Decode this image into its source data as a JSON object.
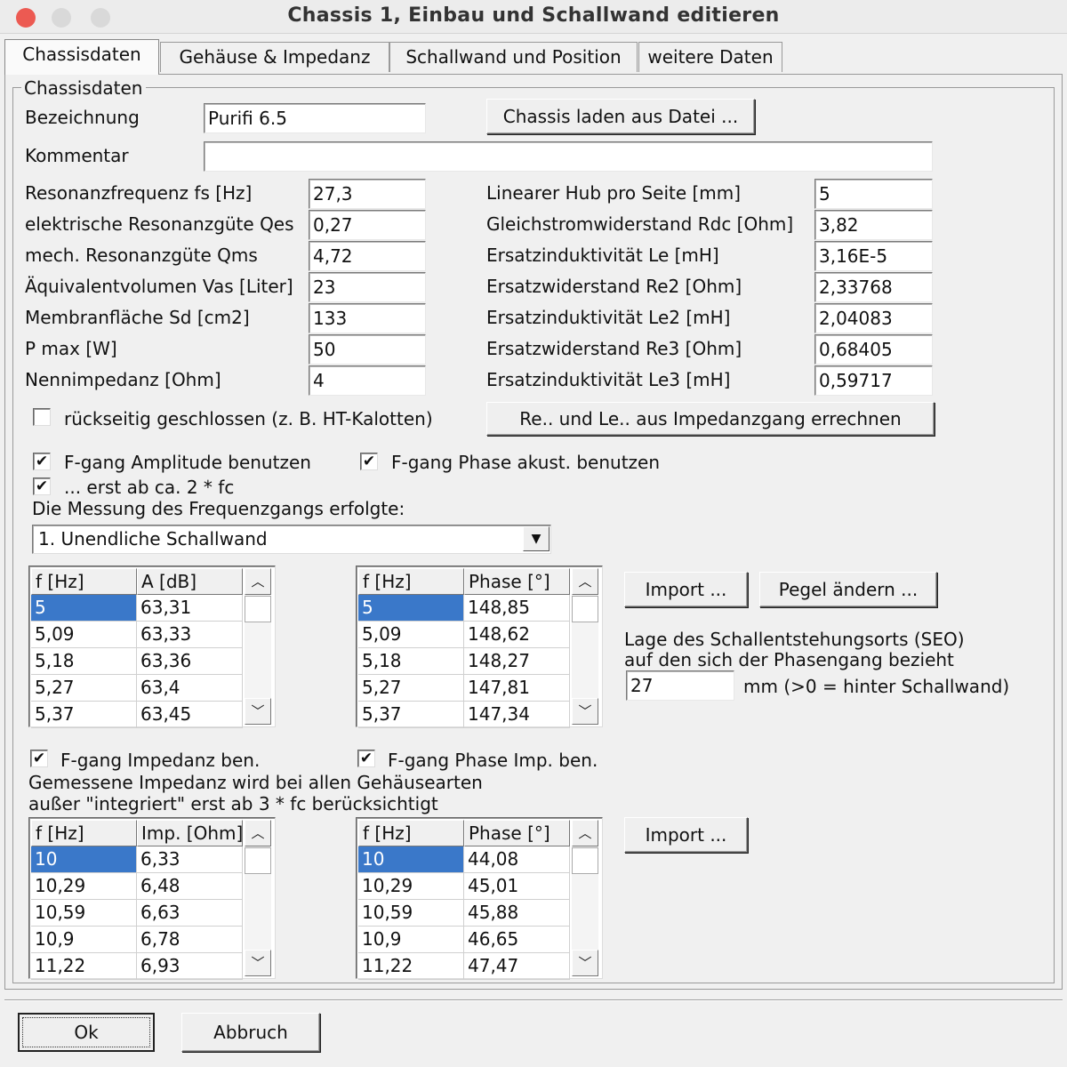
{
  "window": {
    "title": "Chassis 1, Einbau und Schallwand editieren"
  },
  "tabs": [
    "Chassisdaten",
    "Gehäuse & Impedanz",
    "Schallwand und Position",
    "weitere Daten"
  ],
  "group_title": "Chassisdaten",
  "bezeichnung": {
    "label": "Bezeichnung",
    "value": "Purifi 6.5"
  },
  "load_button": "Chassis laden aus Datei ...",
  "kommentar": {
    "label": "Kommentar",
    "value": ""
  },
  "params_left": [
    {
      "label": "Resonanzfrequenz fs [Hz]",
      "value": "27,3"
    },
    {
      "label": "elektrische Resonanzgüte Qes",
      "value": "0,27"
    },
    {
      "label": "mech. Resonanzgüte Qms",
      "value": "4,72"
    },
    {
      "label": "Äquivalentvolumen Vas [Liter]",
      "value": "23"
    },
    {
      "label": "Membranfläche Sd [cm2]",
      "value": "133"
    },
    {
      "label": "P max  [W]",
      "value": "50"
    },
    {
      "label": "Nennimpedanz  [Ohm]",
      "value": "4"
    }
  ],
  "params_right": [
    {
      "label": "Linearer Hub pro Seite [mm]",
      "value": "5"
    },
    {
      "label": "Gleichstromwiderstand Rdc [Ohm]",
      "value": "3,82"
    },
    {
      "label": "Ersatzinduktivität Le [mH]",
      "value": "3,16E-5"
    },
    {
      "label": "Ersatzwiderstand Re2 [Ohm]",
      "value": "2,33768"
    },
    {
      "label": "Ersatzinduktivität Le2 [mH]",
      "value": "2,04083"
    },
    {
      "label": "Ersatzwiderstand Re3 [Ohm]",
      "value": "0,68405"
    },
    {
      "label": "Ersatzinduktivität Le3 [mH]",
      "value": "0,59717"
    }
  ],
  "rear_closed": {
    "label": "rückseitig geschlossen (z. B. HT-Kalotten)",
    "checked": false
  },
  "calc_button": "Re.. und Le.. aus Impedanzgang errechnen",
  "fgang_amp": {
    "label": "F-gang Amplitude benutzen",
    "checked": true
  },
  "fgang_phase": {
    "label": "F-gang Phase akust. benutzen",
    "checked": true
  },
  "erst_ab": {
    "label": "... erst ab ca. 2 * fc",
    "checked": true
  },
  "measurement_label": "Die Messung des Frequenzgangs erfolgte:",
  "measurement_value": "1. Unendliche Schallwand",
  "amp_table": {
    "headers": [
      "f [Hz]",
      "A [dB]"
    ],
    "rows": [
      [
        "5",
        "63,31"
      ],
      [
        "5,09",
        "63,33"
      ],
      [
        "5,18",
        "63,36"
      ],
      [
        "5,27",
        "63,4"
      ],
      [
        "5,37",
        "63,45"
      ]
    ]
  },
  "phase_table": {
    "headers": [
      "f [Hz]",
      "Phase [°]"
    ],
    "rows": [
      [
        "5",
        "148,85"
      ],
      [
        "5,09",
        "148,62"
      ],
      [
        "5,18",
        "148,27"
      ],
      [
        "5,27",
        "147,81"
      ],
      [
        "5,37",
        "147,34"
      ]
    ]
  },
  "import_button": "Import ...",
  "pegel_button": "Pegel ändern ...",
  "seo": {
    "line1": "Lage des Schallentstehungsorts (SEO)",
    "line2": "auf den sich der Phasengang bezieht",
    "value": "27",
    "unit": "mm  (>0 = hinter Schallwand)"
  },
  "imp_check": {
    "label": "F-gang Impedanz ben.",
    "checked": true
  },
  "imp_phase_check": {
    "label": "F-gang Phase Imp. ben.",
    "checked": true
  },
  "imp_note": {
    "line1": "Gemessene Impedanz wird bei allen Gehäusearten",
    "line2": "außer \"integriert\" erst ab 3 * fc berücksichtigt"
  },
  "imp_table": {
    "headers": [
      "f [Hz]",
      "Imp. [Ohm]"
    ],
    "rows": [
      [
        "10",
        "6,33"
      ],
      [
        "10,29",
        "6,48"
      ],
      [
        "10,59",
        "6,63"
      ],
      [
        "10,9",
        "6,78"
      ],
      [
        "11,22",
        "6,93"
      ]
    ]
  },
  "imp_phase_table": {
    "headers": [
      "f [Hz]",
      "Phase [°]"
    ],
    "rows": [
      [
        "10",
        "44,08"
      ],
      [
        "10,29",
        "45,01"
      ],
      [
        "10,59",
        "45,88"
      ],
      [
        "10,9",
        "46,65"
      ],
      [
        "11,22",
        "47,47"
      ]
    ]
  },
  "import_button2": "Import ...",
  "ok_button": "Ok",
  "cancel_button": "Abbruch",
  "icons": {
    "check": "✔",
    "scroll_up": "︿",
    "scroll_down": "﹀",
    "combo": "▼"
  }
}
